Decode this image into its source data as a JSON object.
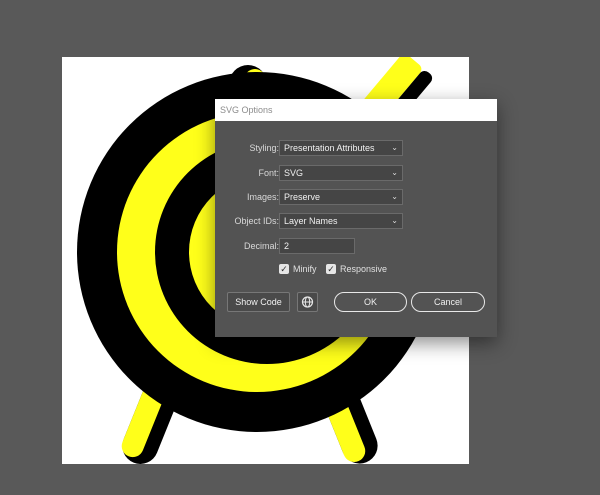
{
  "dialog": {
    "title": "SVG Options",
    "fields": {
      "styling": {
        "label": "Styling:",
        "value": "Presentation Attributes"
      },
      "font": {
        "label": "Font:",
        "value": "SVG"
      },
      "images": {
        "label": "Images:",
        "value": "Preserve"
      },
      "object_ids": {
        "label": "Object IDs:",
        "value": "Layer Names"
      },
      "decimal": {
        "label": "Decimal:",
        "value": "2"
      }
    },
    "checkboxes": {
      "minify": {
        "label": "Minify",
        "checked": true
      },
      "responsive": {
        "label": "Responsive",
        "checked": true
      }
    },
    "buttons": {
      "show_code": "Show Code",
      "ok": "OK",
      "cancel": "Cancel"
    },
    "check_glyph": "✓",
    "chevron_glyph": "⌄"
  },
  "icons": {
    "globe": "globe-icon",
    "chevron": "chevron-down-icon"
  },
  "colors": {
    "canvas_bg": "#595959",
    "dialog_bg": "#535353",
    "target_black": "#000000",
    "target_yellow": "#ffff1a"
  }
}
